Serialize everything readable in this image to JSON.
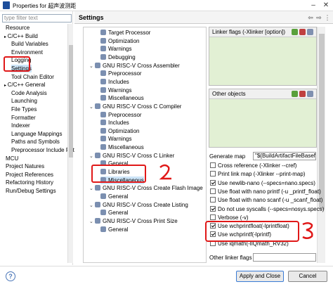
{
  "window": {
    "title": "Properties for 超声波测距"
  },
  "filter": {
    "placeholder": "type filter text"
  },
  "left_tree": [
    "Resource",
    "C/C++ Build",
    "Build Variables",
    "Environment",
    "Logging",
    "Settings",
    "Tool Chain Editor",
    "C/C++ General",
    "Code Analysis",
    "Launching",
    "File Types",
    "Formatter",
    "Indexer",
    "Language Mappings",
    "Paths and Symbols",
    "Preprocessor Include Pat",
    "MCU",
    "Project Natures",
    "Project References",
    "Refactoring History",
    "Run/Debug Settings"
  ],
  "header": {
    "title": "Settings"
  },
  "mid_tree": [
    "Target Processor",
    "Optimization",
    "Warnings",
    "Debugging",
    "GNU RISC-V Cross Assembler",
    "Preprocessor",
    "Includes",
    "Warnings",
    "Miscellaneous",
    "GNU RISC-V Cross C Compiler",
    "Preprocessor",
    "Includes",
    "Optimization",
    "Warnings",
    "Miscellaneous",
    "GNU RISC-V Cross C Linker",
    "General",
    "Libraries",
    "Miscellaneous",
    "GNU RISC-V Cross Create Flash Image",
    "General",
    "GNU RISC-V Cross Create Listing",
    "General",
    "GNU RISC-V Cross Print Size",
    "General"
  ],
  "linker_panel": {
    "title": "Linker flags (-Xlinker [option])"
  },
  "objects_panel": {
    "title": "Other objects"
  },
  "generate_map": {
    "label": "Generate map",
    "value": "\"${BuildArtifactFileBaseName}.map\""
  },
  "options": [
    {
      "label": "Cross reference (-Xlinker --cref)",
      "checked": false
    },
    {
      "label": "Print link map (-Xlinker --print-map)",
      "checked": false
    },
    {
      "label": "Use newlib-nano (--specs=nano.specs)",
      "checked": true
    },
    {
      "label": "Use float with nano printf (-u _printf_float)",
      "checked": false
    },
    {
      "label": "Use float with nano scanf (-u _scanf_float)",
      "checked": false
    },
    {
      "label": "Do not use syscalls (--specs=nosys.specs)",
      "checked": true
    },
    {
      "label": "Verbose (-v)",
      "checked": false
    },
    {
      "label": "Use wchprintfloat(-lprintfloat)",
      "checked": true
    },
    {
      "label": "Use wchprintf(-lprintf)",
      "checked": true
    },
    {
      "label": "Use iqmath(-lIQmath_RV32)",
      "checked": false
    }
  ],
  "other_linker_flags": {
    "label": "Other linker flags",
    "value": ""
  },
  "footer": {
    "help": "?",
    "apply_close": "Apply and Close",
    "cancel": "Cancel"
  }
}
